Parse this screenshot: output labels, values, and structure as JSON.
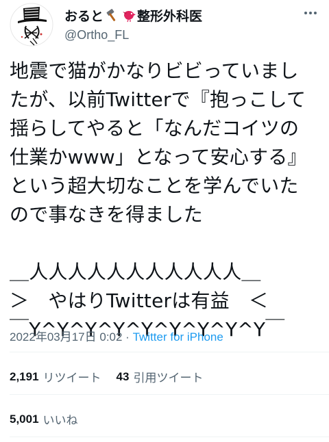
{
  "author": {
    "display_name_prefix": "おると",
    "display_name_suffix": "整形外科医",
    "handle": "@Ortho_FL",
    "badge_icons": [
      "hammer-icon",
      "bird-icon"
    ]
  },
  "tweet": {
    "lines": [
      "地震で猫がかなりビビっていまし",
      "たが、以前Twitterで『抱っこして",
      "揺らしてやると「なんだコイツの",
      "仕業かwww」となって安心する』",
      "という超大切なことを学んでいた",
      "ので事なきを得ました",
      "",
      "＿人人人人人人人人人人人＿",
      "＞　やはりTwitterは有益　＜",
      "￣Y^Y^Y^Y^Y^Y^Y^Y^Y￣"
    ],
    "timestamp": "2022年03月17日 0:02",
    "separator": " · ",
    "source": "Twitter for iPhone"
  },
  "stats": {
    "retweets": "2,191",
    "retweets_label": "リツイート",
    "quotes": "43",
    "quotes_label": "引用ツイート",
    "likes": "5,001",
    "likes_label": "いいね"
  },
  "colors": {
    "text": "#0f1419",
    "secondary": "#536471",
    "link": "#1d9bf0",
    "divider": "#eff3f4"
  }
}
